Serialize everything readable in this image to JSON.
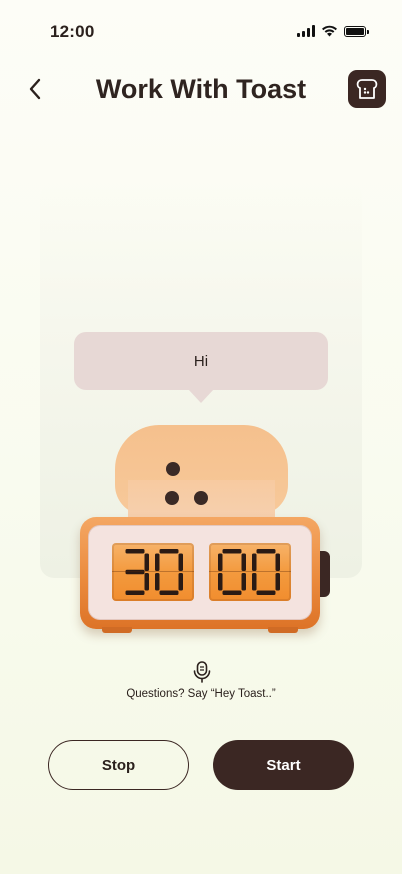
{
  "status_bar": {
    "time": "12:00"
  },
  "header": {
    "title": "Work With Toast"
  },
  "icons": {
    "back": "chevron-left-icon",
    "toast_menu": "toast-face-icon",
    "mic": "microphone-icon",
    "signal": "cellular-signal-icon",
    "wifi": "wifi-icon",
    "battery": "battery-icon"
  },
  "speech_bubble": {
    "text": "Hi"
  },
  "timer": {
    "minutes": "30",
    "seconds": "00"
  },
  "hint": {
    "text": "Questions? Say “Hey Toast..”"
  },
  "buttons": {
    "stop": "Stop",
    "start": "Start"
  },
  "colors": {
    "accent_dark": "#3b2723",
    "clock_orange": "#eb8b3e",
    "bubble": "#e7d8d5",
    "toast": "#f5c08d"
  }
}
